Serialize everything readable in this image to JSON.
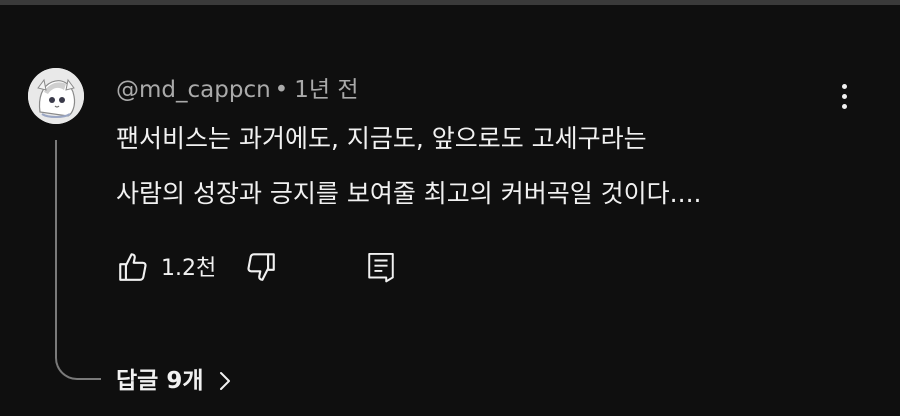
{
  "comment": {
    "author": "@md_cappcn",
    "separator": "•",
    "time": "1년 전",
    "text_line1": "팬서비스는 과거에도, 지금도, 앞으로도 고세구라는",
    "text_line2": "사람의 성장과 긍지를 보여줄 최고의 커버곡일 것이다....",
    "like_count": "1.2천"
  },
  "replies": {
    "label": "답글 9개"
  },
  "icons": {
    "like": "thumbs-up-icon",
    "dislike": "thumbs-down-icon",
    "reply": "reply-comment-icon",
    "more": "more-vert-icon",
    "expand": "chevron-right-icon"
  },
  "colors": {
    "background": "#0f0f0f",
    "text": "#f1f1f1",
    "meta_text": "#aaaaaa"
  }
}
